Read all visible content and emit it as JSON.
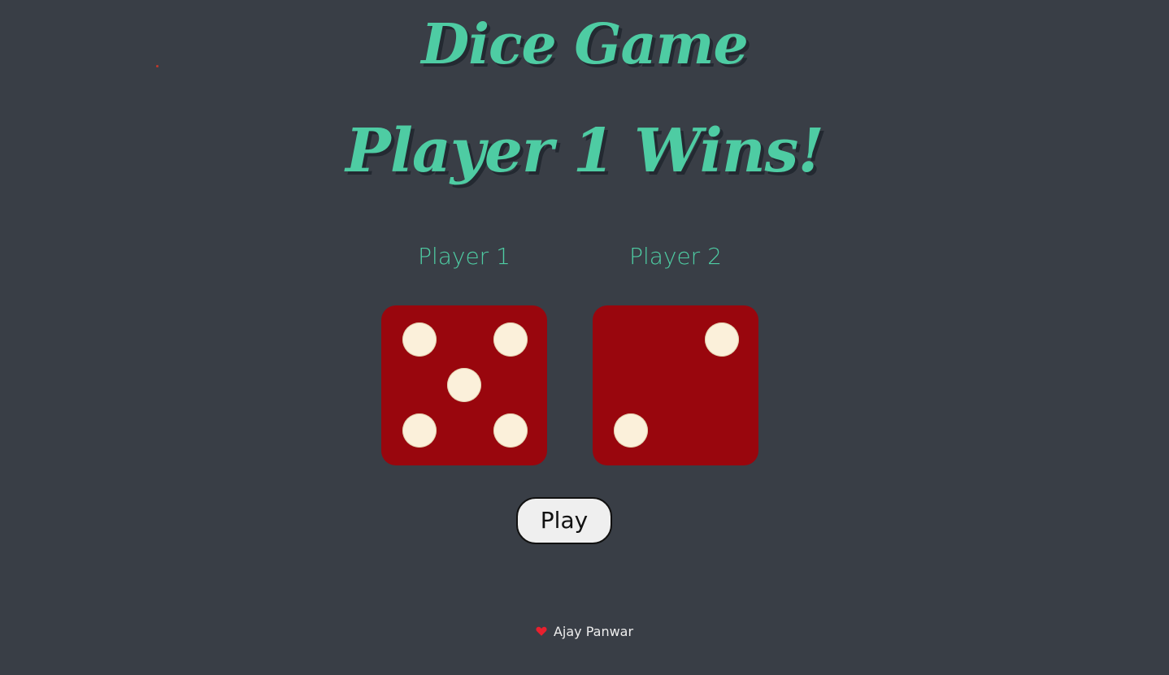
{
  "header": {
    "title": "Dice Game",
    "result": "Player 1 Wins!"
  },
  "players": [
    {
      "label": "Player 1",
      "die_value": 5
    },
    {
      "label": "Player 2",
      "die_value": 2
    }
  ],
  "controls": {
    "play_label": "Play"
  },
  "footer": {
    "icon": "heart-icon",
    "author": "Ajay Panwar"
  },
  "colors": {
    "background": "#393e46",
    "accent": "#4ecca3",
    "die": "#99060d",
    "pip": "#fbf0da",
    "heart": "#e8202e"
  }
}
